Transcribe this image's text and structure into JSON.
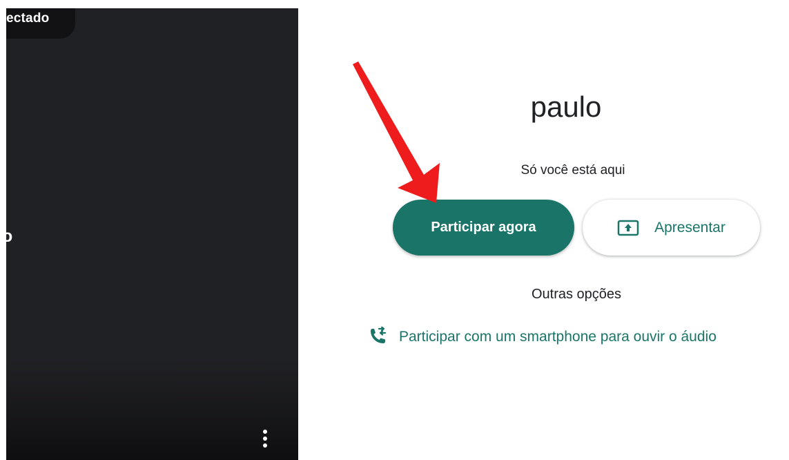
{
  "preview": {
    "status_text": "ectado",
    "label_fragment": "o",
    "more_options_icon": "more-vertical-icon"
  },
  "lobby": {
    "user_name": "paulo",
    "presence_text": "Só você está aqui",
    "join_label": "Participar agora",
    "present_label": "Apresentar",
    "present_icon": "present-screen-icon",
    "other_options_label": "Outras opções",
    "phone_join_label": "Participar com um smartphone para ouvir o áudio",
    "phone_icon": "phone-forward-icon"
  },
  "annotation": {
    "arrow_color": "#ee1c1c",
    "arrow_icon": "red-arrow-annotation"
  },
  "colors": {
    "accent": "#1a7568",
    "preview_bg": "#202124",
    "text": "#202124"
  }
}
